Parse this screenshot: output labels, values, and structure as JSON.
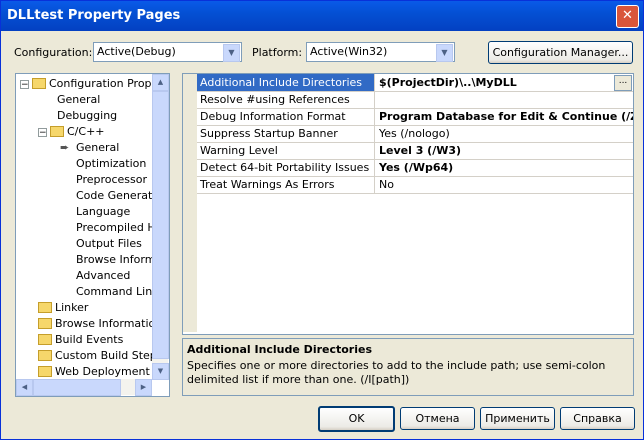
{
  "window": {
    "title": "DLLtest Property Pages",
    "close_glyph": "✕"
  },
  "config": {
    "label": "Configuration:",
    "value": "Active(Debug)"
  },
  "platform": {
    "label": "Platform:",
    "value": "Active(Win32)"
  },
  "config_manager_label": "Configuration Manager...",
  "tree": [
    {
      "label": "Configuration Propertie",
      "level": 0,
      "folder": true,
      "expand": "−"
    },
    {
      "label": "General",
      "level": 1
    },
    {
      "label": "Debugging",
      "level": 1
    },
    {
      "label": "C/C++",
      "level": 1,
      "folder": true,
      "expand": "−"
    },
    {
      "label": "General",
      "level": 2,
      "current": true
    },
    {
      "label": "Optimization",
      "level": 2
    },
    {
      "label": "Preprocessor",
      "level": 2
    },
    {
      "label": "Code Generatio",
      "level": 2
    },
    {
      "label": "Language",
      "level": 2
    },
    {
      "label": "Precompiled He",
      "level": 2
    },
    {
      "label": "Output Files",
      "level": 2
    },
    {
      "label": "Browse Informa",
      "level": 2
    },
    {
      "label": "Advanced",
      "level": 2
    },
    {
      "label": "Command Line",
      "level": 2
    },
    {
      "label": "Linker",
      "level": 1,
      "folder": true,
      "expand": "+"
    },
    {
      "label": "Browse Information",
      "level": 1,
      "folder": true,
      "expand": "+"
    },
    {
      "label": "Build Events",
      "level": 1,
      "folder": true,
      "expand": "+"
    },
    {
      "label": "Custom Build Step",
      "level": 1,
      "folder": true,
      "expand": "+"
    },
    {
      "label": "Web Deployment",
      "level": 1,
      "folder": true,
      "expand": "+"
    }
  ],
  "properties": [
    {
      "name": "Additional Include Directories",
      "value": "$(ProjectDir)\\..\\MyDLL",
      "bold": true,
      "selected": true,
      "ellipsis": "..."
    },
    {
      "name": "Resolve #using References",
      "value": ""
    },
    {
      "name": "Debug Information Format",
      "value": "Program Database for Edit & Continue (/ZI)",
      "bold": true
    },
    {
      "name": "Suppress Startup Banner",
      "value": "Yes (/nologo)"
    },
    {
      "name": "Warning Level",
      "value": "Level 3 (/W3)",
      "bold": true
    },
    {
      "name": "Detect 64-bit Portability Issues",
      "value": "Yes (/Wp64)",
      "bold": true
    },
    {
      "name": "Treat Warnings As Errors",
      "value": "No"
    }
  ],
  "description": {
    "title": "Additional Include Directories",
    "text": "Specifies one or more directories to add to the include path; use semi-colon delimited list if more than one.     (/I[path])"
  },
  "buttons": {
    "ok": "OK",
    "cancel": "Отмена",
    "apply": "Применить",
    "help": "Справка"
  },
  "arrows": {
    "down": "▼",
    "up": "▲",
    "left": "◀",
    "right": "▶"
  },
  "current_marker": "➨"
}
